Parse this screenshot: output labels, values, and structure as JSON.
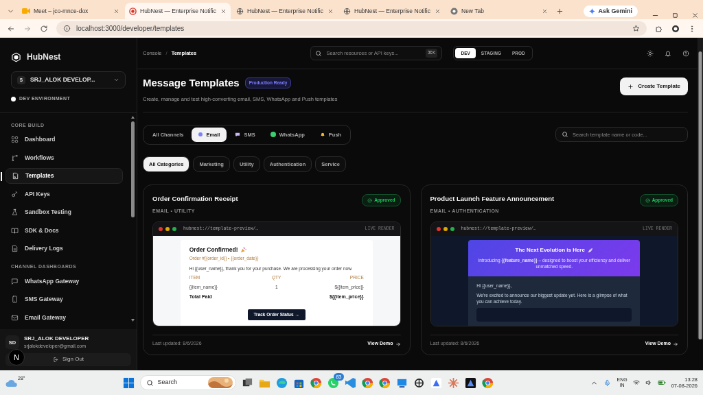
{
  "browser": {
    "tabs": [
      {
        "title": "Meet – jco-mnce-dox",
        "selected": false
      },
      {
        "title": "HubNest — Enterprise Notific",
        "selected": true
      },
      {
        "title": "HubNest — Enterprise Notific",
        "selected": false
      },
      {
        "title": "HubNest — Enterprise Notific",
        "selected": false
      },
      {
        "title": "New Tab",
        "selected": false
      }
    ],
    "assistant": "Ask Gemini",
    "url": "localhost:3000/developer/templates"
  },
  "sidebar": {
    "brand": "HubNest",
    "workspace": {
      "initial": "S",
      "name": "SRJ_ALOK DEVELOP..."
    },
    "environment": "DEV ENVIRONMENT",
    "sections": [
      {
        "title": "CORE BUILD",
        "items": [
          {
            "label": "Dashboard",
            "selected": false
          },
          {
            "label": "Workflows",
            "selected": false
          },
          {
            "label": "Templates",
            "selected": true
          },
          {
            "label": "API Keys",
            "selected": false
          },
          {
            "label": "Sandbox Testing",
            "selected": false
          },
          {
            "label": "SDK & Docs",
            "selected": false
          },
          {
            "label": "Delivery Logs",
            "selected": false
          }
        ]
      },
      {
        "title": "CHANNEL DASHBOARDS",
        "items": [
          {
            "label": "WhatsApp Gateway",
            "selected": false
          },
          {
            "label": "SMS Gateway",
            "selected": false
          },
          {
            "label": "Email Gateway",
            "selected": false
          }
        ]
      }
    ],
    "user": {
      "initials": "SD",
      "name": "SRJ_ALOK DEVELOPER",
      "email": "srjalokdeveloper@gmail.com"
    },
    "sign_out": "Sign Out",
    "dev_badge": "N"
  },
  "topbar": {
    "breadcrumb": [
      "Console",
      "/",
      "Templates"
    ],
    "search": {
      "placeholder": "Search resources or API keys...",
      "shortcut": "⌘K"
    },
    "environments": [
      {
        "label": "DEV",
        "selected": true
      },
      {
        "label": "STAGING",
        "selected": false
      },
      {
        "label": "PROD",
        "selected": false
      }
    ]
  },
  "header": {
    "title": "Message Templates",
    "badge": "Production Ready",
    "subtitle": "Create, manage and test high-converting email, SMS, WhatsApp and Push templates",
    "create_button": "Create Template"
  },
  "channel_tabs": [
    {
      "label": "All Channels",
      "selected": false
    },
    {
      "label": "Email",
      "selected": true
    },
    {
      "label": "SMS",
      "selected": false
    },
    {
      "label": "WhatsApp",
      "selected": false
    },
    {
      "label": "Push",
      "selected": false
    }
  ],
  "template_search": {
    "placeholder": "Search template name or code..."
  },
  "categories": [
    {
      "label": "All Categories",
      "selected": true
    },
    {
      "label": "Marketing",
      "selected": false
    },
    {
      "label": "Utility",
      "selected": false
    },
    {
      "label": "Authentication",
      "selected": false
    },
    {
      "label": "Service",
      "selected": false
    }
  ],
  "templates": [
    {
      "title": "Order Confirmation Receipt",
      "meta": "EMAIL • UTILITY",
      "status": "Approved",
      "updated": "Last updated: 8/6/2026",
      "link": "View Demo",
      "preview": {
        "kind": "receipt",
        "url": "hubnest://template-preview/…",
        "mode": "LIVE RENDER",
        "heading": "Order Confirmed!",
        "subheading": "Order #{{order_id}} • {{order_date}}",
        "greeting": "Hi {{user_name}}, thank you for your purchase. We are processing your order now.",
        "columns": [
          "ITEM",
          "QTY",
          "PRICE"
        ],
        "row": [
          "{{item_name}}",
          "1",
          "${{item_price}}"
        ],
        "total_label": "Total Paid",
        "total": "${{item_price}}",
        "button": "Track Order Status →"
      }
    },
    {
      "title": "Product Launch Feature Announcement",
      "meta": "EMAIL • AUTHENTICATION",
      "status": "Approved",
      "updated": "Last updated: 8/6/2026",
      "link": "View Demo",
      "preview": {
        "kind": "launch",
        "url": "hubnest://template-preview/…",
        "mode": "LIVE RENDER",
        "heading": "The Next Evolution is Here",
        "intro": "Introducing **{{feature_name}}** – designed to boost your efficiency and deliver unmatched speed.",
        "greeting": "Hi {{user_name}},",
        "body": "We're excited to announce our biggest update yet. Here is a glimpse of what you can achieve today."
      }
    }
  ],
  "taskbar": {
    "weather": "28°",
    "search": "Search",
    "badge": "83",
    "language": "ENG",
    "region": "IN",
    "time": "13:28",
    "date": "07-08-2026"
  }
}
